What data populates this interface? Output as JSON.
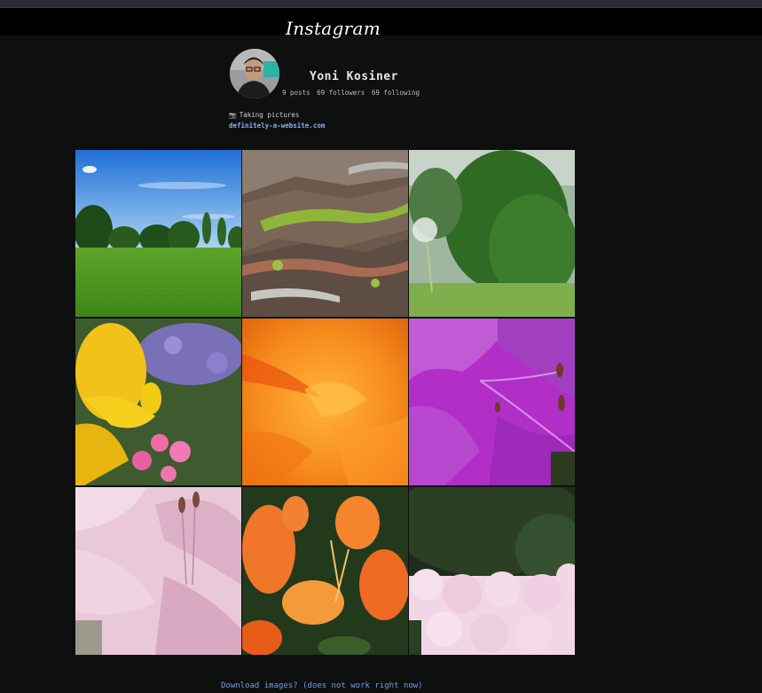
{
  "header": {
    "logo_text": "Instagram"
  },
  "profile": {
    "username": "Yoni Kosiner",
    "stats": {
      "posts": "9 posts",
      "followers": "69 followers",
      "following": "69 following"
    },
    "bio": {
      "icon": "camera-icon",
      "text": "Taking pictures"
    },
    "website": "definitely-a-website.com"
  },
  "photos": [
    {
      "subject": "park-sky"
    },
    {
      "subject": "tree-bark-moss"
    },
    {
      "subject": "dandelion-trees"
    },
    {
      "subject": "yellow-azalea"
    },
    {
      "subject": "orange-flower-closeup"
    },
    {
      "subject": "purple-rhododendron"
    },
    {
      "subject": "pale-pink-azalea"
    },
    {
      "subject": "orange-azalea"
    },
    {
      "subject": "pink-rhododendron-bush"
    }
  ],
  "footer": {
    "download_link": "Download images? (does not work right now)"
  },
  "colors": {
    "background": "#0e0f0f",
    "header": "#000000",
    "link": "#7fb5f0"
  }
}
